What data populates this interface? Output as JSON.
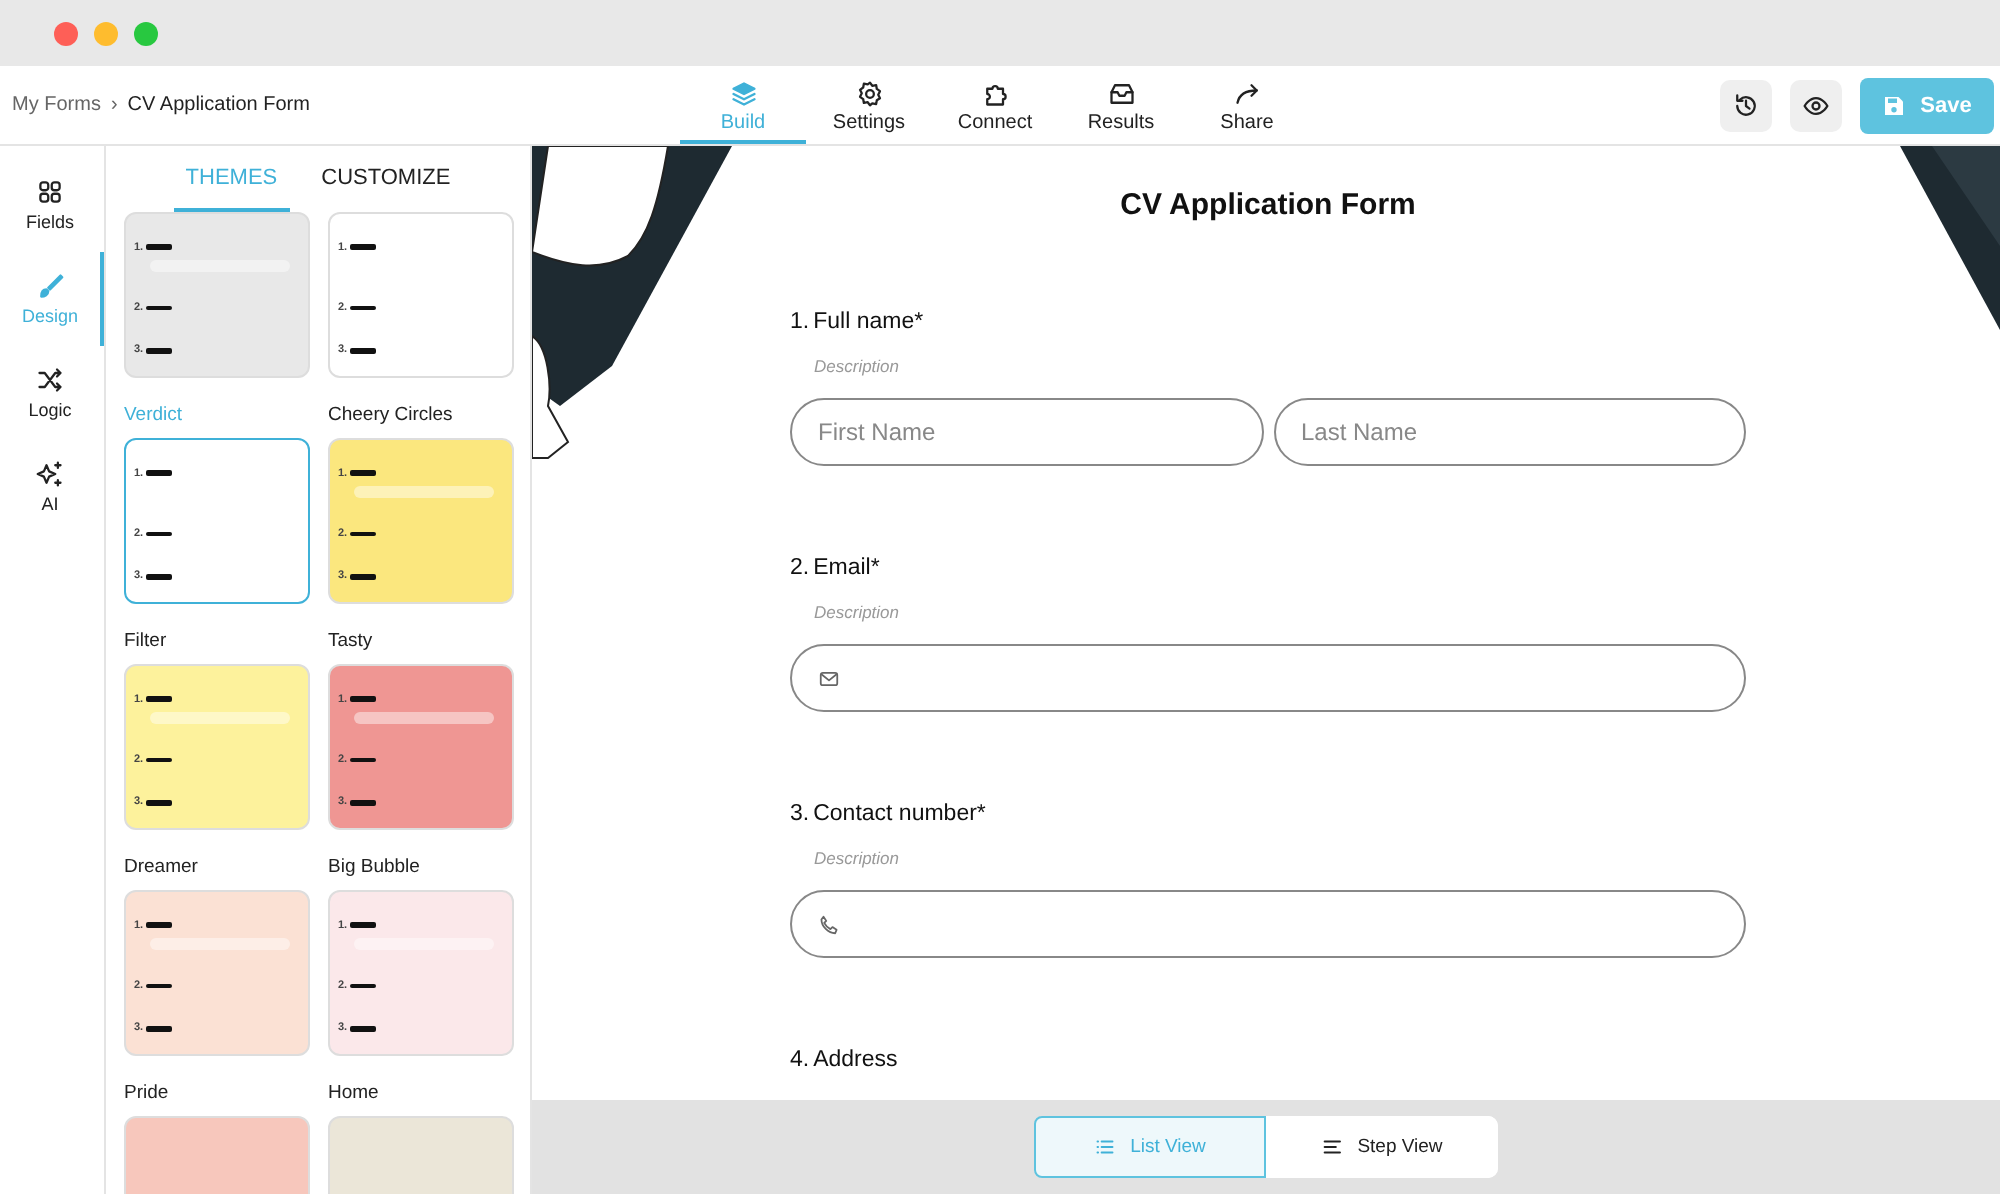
{
  "breadcrumb": {
    "parent": "My Forms",
    "separator": "›",
    "current": "CV Application Form"
  },
  "nav_tabs": [
    {
      "label": "Build",
      "selected": true
    },
    {
      "label": "Settings",
      "selected": false
    },
    {
      "label": "Connect",
      "selected": false
    },
    {
      "label": "Results",
      "selected": false
    },
    {
      "label": "Share",
      "selected": false
    }
  ],
  "save_button": "Save",
  "rail": [
    {
      "label": "Fields",
      "selected": false
    },
    {
      "label": "Design",
      "selected": true
    },
    {
      "label": "Logic",
      "selected": false
    },
    {
      "label": "AI",
      "selected": false
    }
  ],
  "panel_tabs": [
    {
      "label": "THEMES",
      "selected": true
    },
    {
      "label": "CUSTOMIZE",
      "selected": false
    }
  ],
  "themes": [
    {
      "selected": false,
      "color": "#e8e8e8",
      "marks": [
        "1.",
        "2.",
        "3."
      ]
    },
    {
      "selected": false,
      "color": "#ffffff",
      "marks": [
        "1.",
        "2.",
        "3."
      ]
    },
    {
      "name": "Verdict",
      "selected": true,
      "color": "#ffffff",
      "marks": [
        "1.",
        "2.",
        "3."
      ]
    },
    {
      "name": "Cheery Circles",
      "selected": false,
      "color": "#fbe77e",
      "marks": [
        "1.",
        "2.",
        "3."
      ]
    },
    {
      "name": "Filter",
      "selected": false,
      "color": "#fdf29c",
      "marks": [
        "1.",
        "2.",
        "3."
      ]
    },
    {
      "name": "Tasty",
      "selected": false,
      "color": "#ef9693",
      "marks": [
        "1.",
        "2.",
        "3."
      ]
    },
    {
      "name": "Dreamer",
      "selected": false,
      "color": "#fbe1d4",
      "marks": [
        "1.",
        "2.",
        "3."
      ]
    },
    {
      "name": "Big Bubble",
      "selected": false,
      "color": "#fbe8ea",
      "marks": [
        "1.",
        "2.",
        "3."
      ]
    },
    {
      "name": "Pride",
      "selected": false,
      "color": "#f7c7bc"
    },
    {
      "name": "Home",
      "selected": false,
      "color": "#ebe6d8"
    }
  ],
  "form": {
    "title": "CV Application Form",
    "questions": [
      {
        "number": "1.",
        "label": "Full name*",
        "description": "Description",
        "kind": "name_pair",
        "placeholders": [
          "First Name",
          "Last Name"
        ]
      },
      {
        "number": "2.",
        "label": "Email*",
        "description": "Description",
        "kind": "email"
      },
      {
        "number": "3.",
        "label": "Contact number*",
        "description": "Description",
        "kind": "phone"
      },
      {
        "number": "4.",
        "label": "Address",
        "kind": "none"
      }
    ]
  },
  "view_toggle": [
    {
      "label": "List View",
      "selected": true
    },
    {
      "label": "Step View",
      "selected": false
    }
  ]
}
